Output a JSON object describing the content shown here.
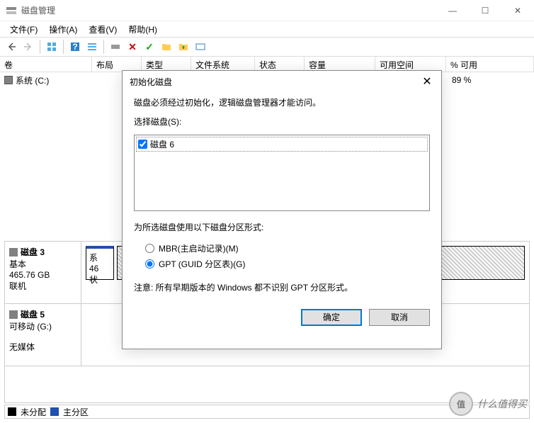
{
  "window": {
    "title": "磁盘管理",
    "min": "—",
    "max": "☐",
    "close": "✕"
  },
  "menu": {
    "file": "文件(F)",
    "action": "操作(A)",
    "view": "查看(V)",
    "help": "帮助(H)"
  },
  "columns": {
    "vol": "卷",
    "layout": "布局",
    "type": "类型",
    "fs": "文件系统",
    "status": "状态",
    "cap": "容量",
    "free": "可用空间",
    "pct": "% 可用"
  },
  "volume": {
    "name": "系统 (C:)",
    "pct": "89 %"
  },
  "disk3": {
    "title": "磁盘 3",
    "type": "基本",
    "size": "465.76 GB",
    "status": "联机",
    "part_prefix": "系",
    "part_l2": "46",
    "part_l3": "状"
  },
  "disk5": {
    "title": "磁盘 5",
    "type": "可移动 (G:)",
    "status": "无媒体"
  },
  "legend": {
    "unalloc": "未分配",
    "primary": "主分区"
  },
  "dialog": {
    "title": "初始化磁盘",
    "msg": "磁盘必须经过初始化，逻辑磁盘管理器才能访问。",
    "select_label": "选择磁盘(S):",
    "disk_item": "磁盘 6",
    "style_label": "为所选磁盘使用以下磁盘分区形式:",
    "mbr": "MBR(主启动记录)(M)",
    "gpt": "GPT (GUID 分区表)(G)",
    "note": "注意: 所有早期版本的 Windows 都不识别 GPT 分区形式。",
    "ok": "确定",
    "cancel": "取消"
  },
  "watermark": {
    "badge": "值",
    "text": "什么值得买"
  }
}
